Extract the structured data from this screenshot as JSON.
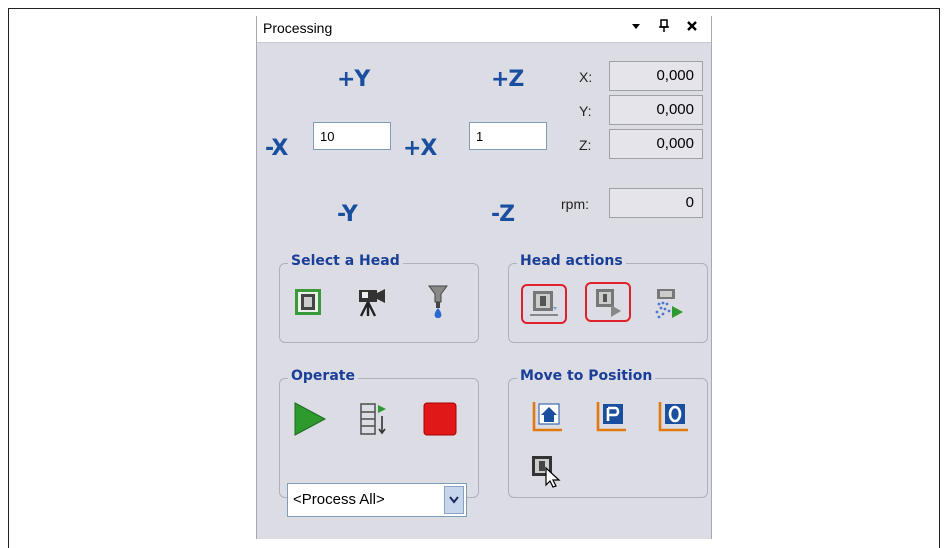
{
  "panel": {
    "title": "Processing",
    "titlebar_buttons": {
      "dropdown": "▾",
      "pin": "ᚬ",
      "close": "✕"
    }
  },
  "jog": {
    "plus_y": "+Y",
    "minus_y": "-Y",
    "plus_x": "+X",
    "minus_x": "-X",
    "plus_z": "+Z",
    "minus_z": "-Z",
    "xy_step_value": "10",
    "z_step_value": "1"
  },
  "position": {
    "x_label": "X:",
    "y_label": "Y:",
    "z_label": "Z:",
    "rpm_label": "rpm:",
    "x_value": "0,000",
    "y_value": "0,000",
    "z_value": "0,000",
    "rpm_value": "0"
  },
  "groups": {
    "select_head": "Select a Head",
    "head_actions": "Head actions",
    "operate": "Operate",
    "move_to_position": "Move to Position"
  },
  "operate": {
    "process_select_value": "<Process All>"
  },
  "colors": {
    "axis_blue": "#1a4fa0",
    "group_title_blue": "#1a3f98",
    "highlight_red": "#e0202a",
    "play_green": "#2e9a2e",
    "stop_red": "#e01818",
    "move_orange": "#e07a10"
  },
  "icons": {
    "select_head": [
      "spindle-head-icon",
      "camera-head-icon",
      "dispenser-head-icon"
    ],
    "head_actions": [
      "head-down-icon",
      "head-run-icon",
      "head-spray-icon"
    ],
    "operate": [
      "play-icon",
      "step-process-icon",
      "stop-icon"
    ],
    "move_to_position": [
      "home-position-icon",
      "park-position-icon",
      "zero-position-icon",
      "move-to-cursor-icon"
    ]
  }
}
